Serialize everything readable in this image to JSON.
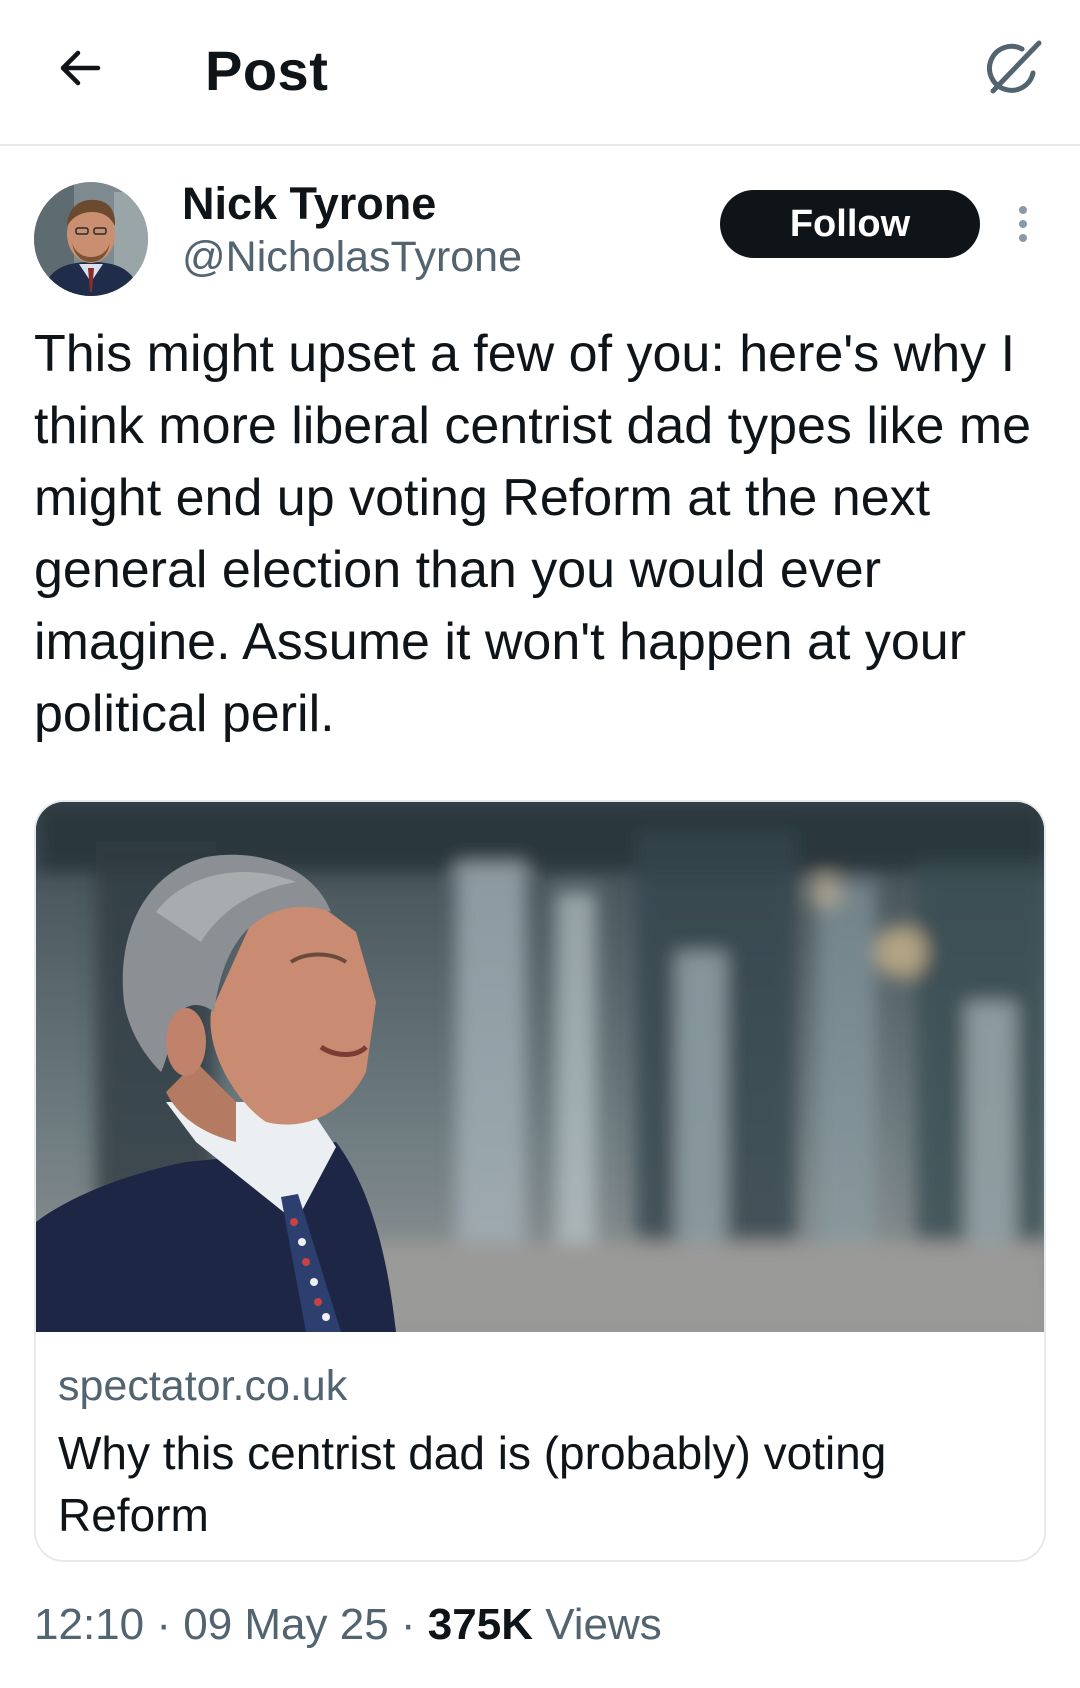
{
  "header": {
    "title": "Post",
    "back_icon": "arrow-left-icon",
    "grok_icon": "grok-slash-icon"
  },
  "author": {
    "display_name": "Nick Tyrone",
    "handle": "@NicholasTyrone",
    "follow_label": "Follow",
    "more_icon": "more-vertical-icon"
  },
  "post": {
    "text": "This might upset a few of you: here's why I think more liberal centrist dad types like me might end up voting Reform at the next general election than you would ever imagine. Assume it won't happen at your political peril."
  },
  "link_card": {
    "domain": "spectator.co.uk",
    "title": "Why this centrist dad is (probably) voting Reform"
  },
  "meta": {
    "time": "12:10",
    "separator": " · ",
    "date": "09 May 25",
    "views_count": "375K",
    "views_label": "Views"
  },
  "colors": {
    "text_primary": "#0f1419",
    "text_secondary": "#536471",
    "border": "#e7e9ea",
    "follow_bg": "#0f1419"
  }
}
